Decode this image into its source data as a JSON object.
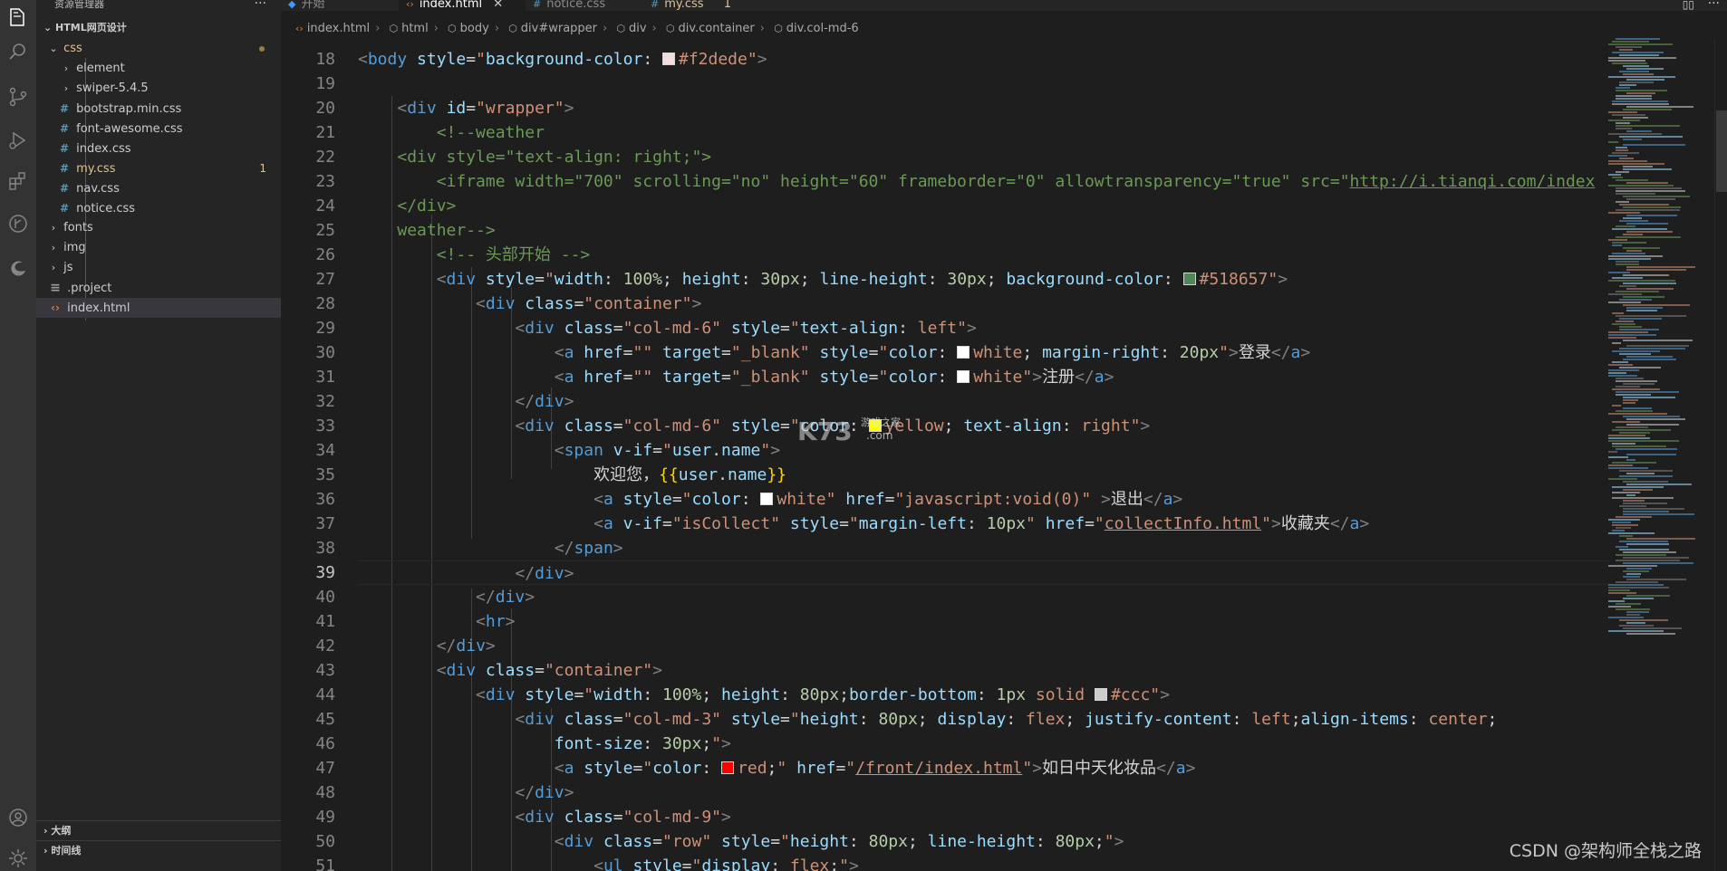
{
  "activity_bar": {
    "icons": [
      "explorer-icon",
      "search-icon",
      "source-control-icon",
      "run-debug-icon",
      "extensions-icon",
      "timeline-icon",
      "edge-icon",
      "account-icon",
      "settings-gear-icon"
    ]
  },
  "sidebar": {
    "title": "资源管理器",
    "more": "···",
    "root": "HTML网页设计",
    "items": [
      {
        "label": "css",
        "type": "folder",
        "expanded": true,
        "modified": true
      },
      {
        "label": "element",
        "type": "folder",
        "expanded": false
      },
      {
        "label": "swiper-5.4.5",
        "type": "folder",
        "expanded": false
      },
      {
        "label": "bootstrap.min.css",
        "type": "css"
      },
      {
        "label": "font-awesome.css",
        "type": "css"
      },
      {
        "label": "index.css",
        "type": "css"
      },
      {
        "label": "my.css",
        "type": "css",
        "modified": true,
        "badge": "1"
      },
      {
        "label": "nav.css",
        "type": "css"
      },
      {
        "label": "notice.css",
        "type": "css"
      },
      {
        "label": "fonts",
        "type": "folder",
        "expanded": false
      },
      {
        "label": "img",
        "type": "folder",
        "expanded": false
      },
      {
        "label": "js",
        "type": "folder",
        "expanded": false
      },
      {
        "label": ".project",
        "type": "file"
      },
      {
        "label": "index.html",
        "type": "html",
        "active": true
      }
    ],
    "sections": [
      "大纲",
      "时间线"
    ]
  },
  "tabs": [
    {
      "label": "开始",
      "icon": "vscode-icon"
    },
    {
      "label": "index.html",
      "icon": "html-icon",
      "active": true,
      "close": "✕"
    },
    {
      "label": "notice.css",
      "icon": "css-icon"
    },
    {
      "label": "my.css",
      "icon": "css-icon",
      "modified": true,
      "badge": "1"
    }
  ],
  "breadcrumbs": [
    "index.html",
    "html",
    "body",
    "div#wrapper",
    "div",
    "div.container",
    "div.col-md-6"
  ],
  "editor": {
    "current_line": 39,
    "line_numbers": [
      18,
      19,
      20,
      21,
      22,
      23,
      24,
      25,
      26,
      27,
      28,
      29,
      30,
      31,
      32,
      33,
      34,
      35,
      36,
      37,
      38,
      39,
      40,
      41,
      42,
      43,
      44,
      45,
      46,
      47,
      48,
      49,
      50,
      51
    ],
    "colors": {
      "f2dede": "#f2dede",
      "518657": "#518657",
      "white": "#ffffff",
      "yellow": "#ffff00",
      "ccc": "#cccccc",
      "red": "#ff0000"
    }
  },
  "watermark": {
    "logo": "K73",
    "sub": "游戏之家",
    ".com": ".com"
  },
  "csdn_watermark": "CSDN @架构师全栈之路"
}
